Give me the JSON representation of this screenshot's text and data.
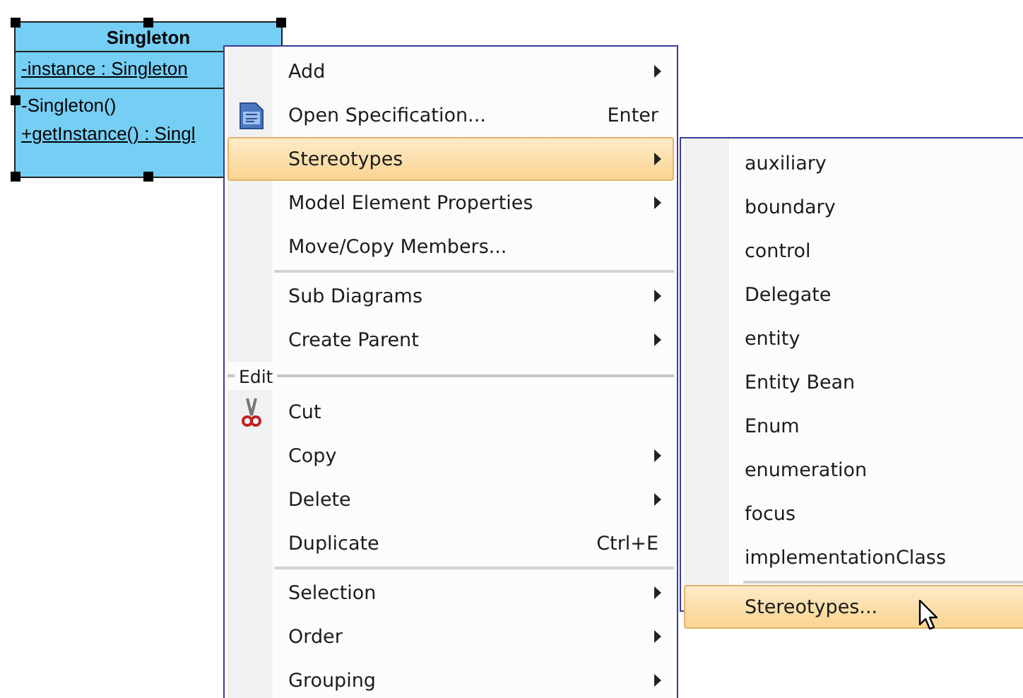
{
  "class_box": {
    "name": "Singleton",
    "selected": true,
    "attributes": [
      {
        "text": "-instance : Singleton",
        "static": true
      }
    ],
    "operations": [
      {
        "text": "-Singleton()",
        "static": false
      },
      {
        "text": "+getInstance() : Singl",
        "static": true
      }
    ]
  },
  "context_menu": {
    "entries": [
      {
        "kind": "item",
        "label": "Add",
        "submenu": true,
        "selected": false
      },
      {
        "kind": "item",
        "label": "Open Specification...",
        "shortcut": "Enter",
        "submenu": false,
        "selected": false
      },
      {
        "kind": "item",
        "label": "Stereotypes",
        "submenu": true,
        "selected": true
      },
      {
        "kind": "item",
        "label": "Model Element Properties",
        "submenu": true,
        "selected": false
      },
      {
        "kind": "item",
        "label": "Move/Copy Members...",
        "submenu": false,
        "selected": false
      },
      {
        "kind": "separator"
      },
      {
        "kind": "item",
        "label": "Sub Diagrams",
        "submenu": true,
        "selected": false
      },
      {
        "kind": "item",
        "label": "Create Parent",
        "submenu": true,
        "selected": false
      },
      {
        "kind": "group",
        "label": "Edit"
      },
      {
        "kind": "item",
        "label": "Cut",
        "submenu": false,
        "selected": false
      },
      {
        "kind": "item",
        "label": "Copy",
        "submenu": true,
        "selected": false
      },
      {
        "kind": "item",
        "label": "Delete",
        "submenu": true,
        "selected": false
      },
      {
        "kind": "item",
        "label": "Duplicate",
        "shortcut": "Ctrl+E",
        "submenu": false,
        "selected": false
      },
      {
        "kind": "separator"
      },
      {
        "kind": "item",
        "label": "Selection",
        "submenu": true,
        "selected": false
      },
      {
        "kind": "item",
        "label": "Order",
        "submenu": true,
        "selected": false
      },
      {
        "kind": "item",
        "label": "Grouping",
        "submenu": true,
        "selected": false
      }
    ]
  },
  "submenu": {
    "entries": [
      {
        "kind": "item",
        "label": "auxiliary",
        "selected": false
      },
      {
        "kind": "item",
        "label": "boundary",
        "selected": false
      },
      {
        "kind": "item",
        "label": "control",
        "selected": false
      },
      {
        "kind": "item",
        "label": "Delegate",
        "selected": false
      },
      {
        "kind": "item",
        "label": "entity",
        "selected": false
      },
      {
        "kind": "item",
        "label": "Entity Bean",
        "selected": false
      },
      {
        "kind": "item",
        "label": "Enum",
        "selected": false
      },
      {
        "kind": "item",
        "label": "enumeration",
        "selected": false
      },
      {
        "kind": "item",
        "label": "focus",
        "selected": false
      },
      {
        "kind": "item",
        "label": "implementationClass",
        "selected": false
      },
      {
        "kind": "separator"
      },
      {
        "kind": "item",
        "label": "Stereotypes...",
        "selected": true
      }
    ]
  }
}
